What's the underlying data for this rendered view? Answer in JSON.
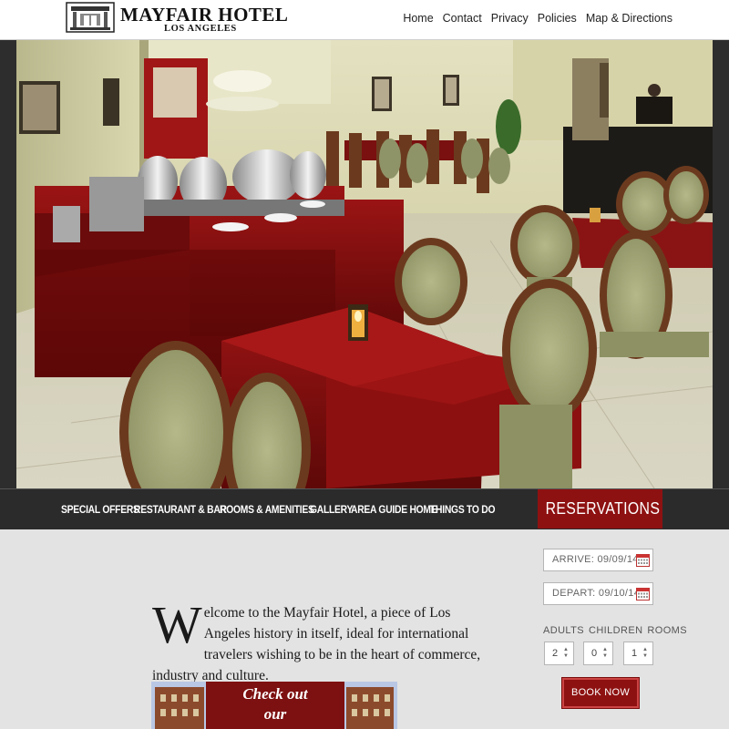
{
  "header": {
    "logo_title": "MAYFAIR HOTEL",
    "logo_subtitle": "LOS ANGELES",
    "top_nav": [
      "Home",
      "Contact",
      "Privacy",
      "Policies",
      "Map & Directions"
    ]
  },
  "main_nav": [
    "SPECIAL OFFERS",
    "RESTAURANT & BAR",
    "ROOMS & AMENITIES",
    "GALLERY",
    "AREA GUIDE HOME",
    "THINGS TO DO"
  ],
  "welcome": {
    "dropcap": "W",
    "text": "elcome to the Mayfair Hotel, a piece of Los Angeles history in itself, ideal for international travelers wishing to be in the heart of commerce, industry and culture."
  },
  "promo": {
    "line1": "Check out",
    "line2": "our"
  },
  "reservations": {
    "title": "RESERVATIONS",
    "arrive": "ARRIVE: 09/09/14",
    "depart": "DEPART: 09/10/14",
    "labels": [
      "ADULTS",
      "CHILDREN",
      "ROOMS"
    ],
    "adults": "2",
    "children": "0",
    "rooms": "1",
    "book_label": "BOOK NOW"
  },
  "hero": {
    "image": "restaurant-dining-room-photo"
  },
  "colors": {
    "accent": "#8e1111",
    "nav_bg": "#2b2b2b",
    "content_bg": "#e3e3e3"
  }
}
